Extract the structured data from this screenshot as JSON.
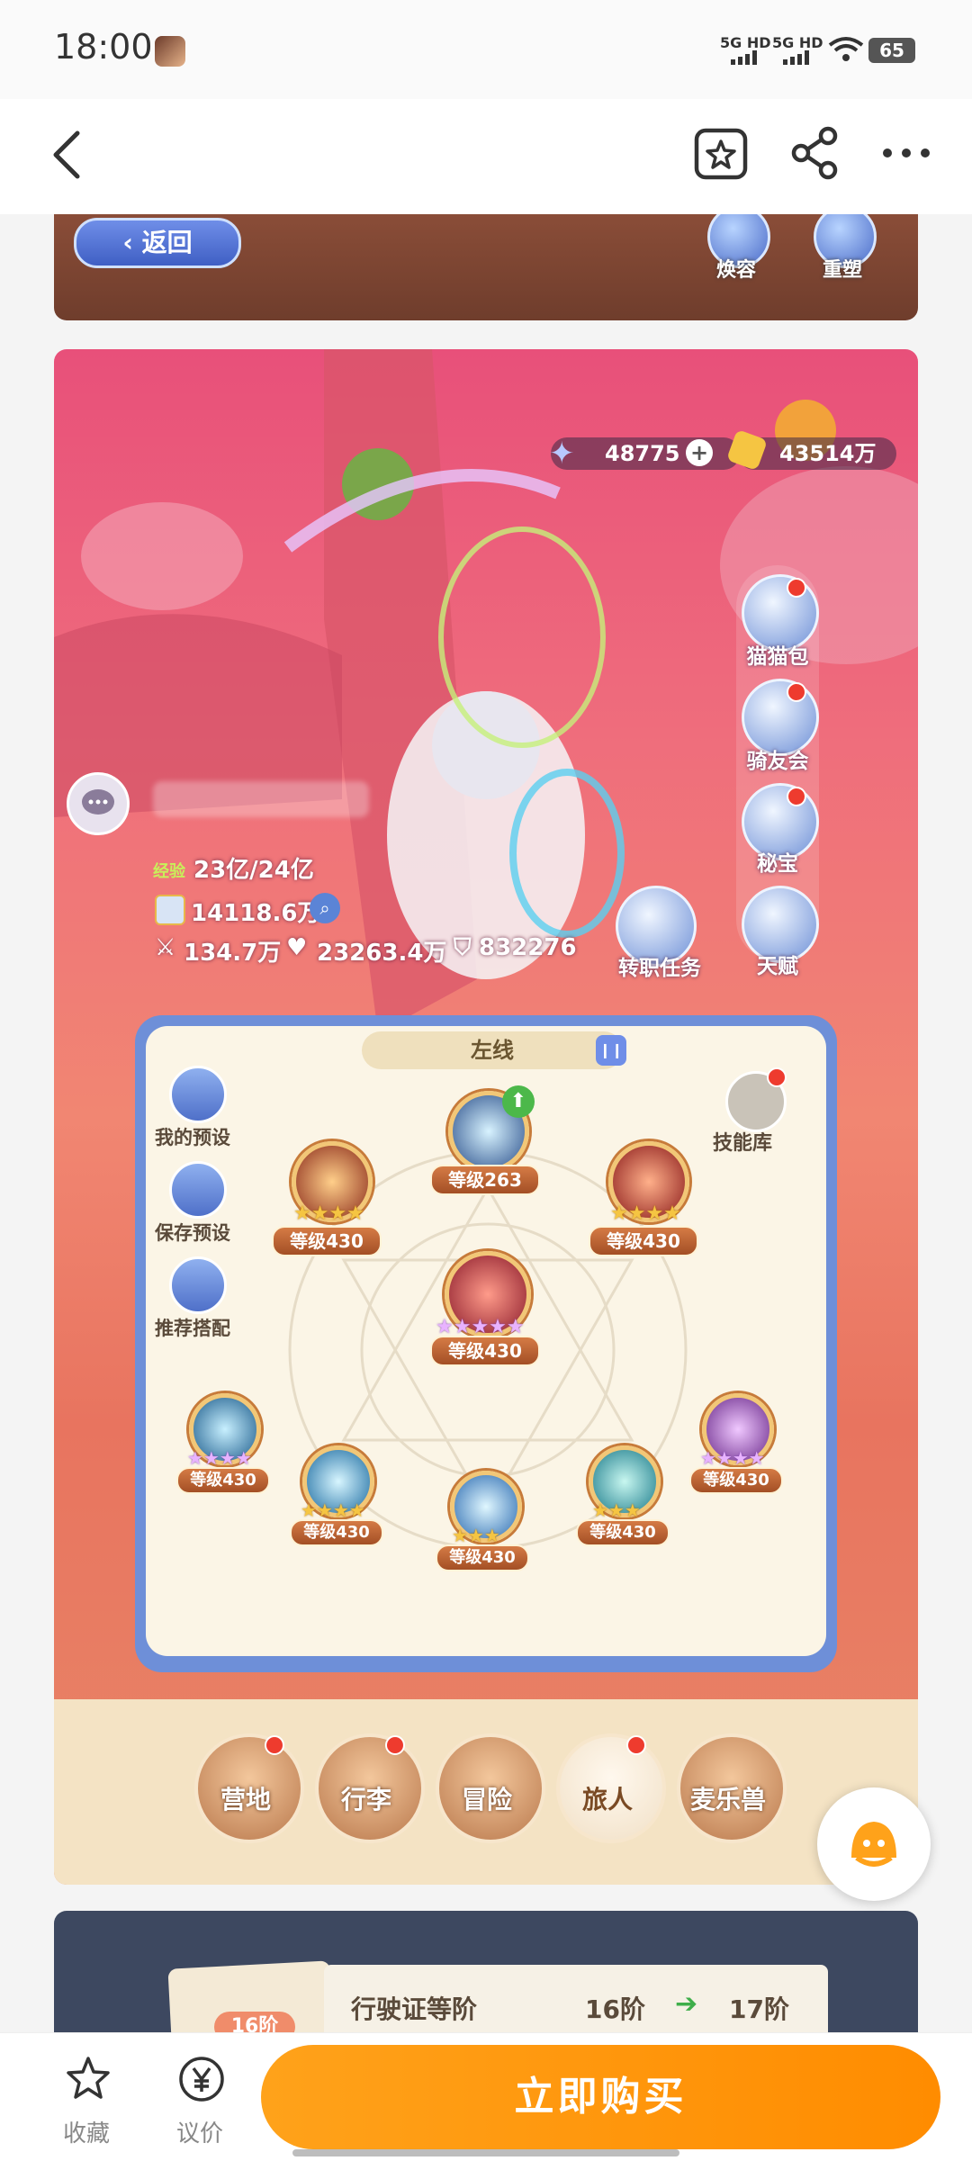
{
  "status_bar": {
    "time": "18:00",
    "network1": "5G HD",
    "network2": "5G HD",
    "battery": "65"
  },
  "header": {
    "back_icon": "chevron-left-icon",
    "fav_icon": "star-square-icon",
    "share_icon": "share-icon",
    "more_icon": "more-icon"
  },
  "top_card": {
    "back_label": "返回",
    "button1": "焕容",
    "button2": "重塑"
  },
  "game": {
    "currency_stars": "48775",
    "currency_coins": "43514万",
    "side_buttons": [
      "猫猫包",
      "骑友会",
      "秘宝",
      "天赋"
    ],
    "exp_label": "经验",
    "exp_value": "23亿/24亿",
    "power": "14118.6万",
    "attack": "134.7万",
    "hp": "23263.4万",
    "defense": "832276",
    "job_task": "转职任务",
    "panel_title": "左线",
    "skill_library": "技能库",
    "left_actions": [
      "我的预设",
      "保存预设",
      "推荐搭配"
    ],
    "skill_levels": {
      "top": "等级263",
      "left": "等级430",
      "right": "等级430",
      "center": "等级430",
      "r1": "等级430",
      "r2": "等级430",
      "r3": "等级430",
      "r4": "等级430",
      "r5": "等级430"
    },
    "tabs": [
      "营地",
      "行李",
      "冒险",
      "旅人",
      "麦乐兽"
    ]
  },
  "card3": {
    "badge": "16阶",
    "row_label": "行驶证等阶",
    "from": "16阶",
    "to": "17阶"
  },
  "bottom_bar": {
    "fav_label": "收藏",
    "bargain_label": "议价",
    "buy_label": "立即购买"
  },
  "colors": {
    "accent": "#ff8c00",
    "panel_blue": "#6e8fd8",
    "game_pink": "#e8507a"
  }
}
